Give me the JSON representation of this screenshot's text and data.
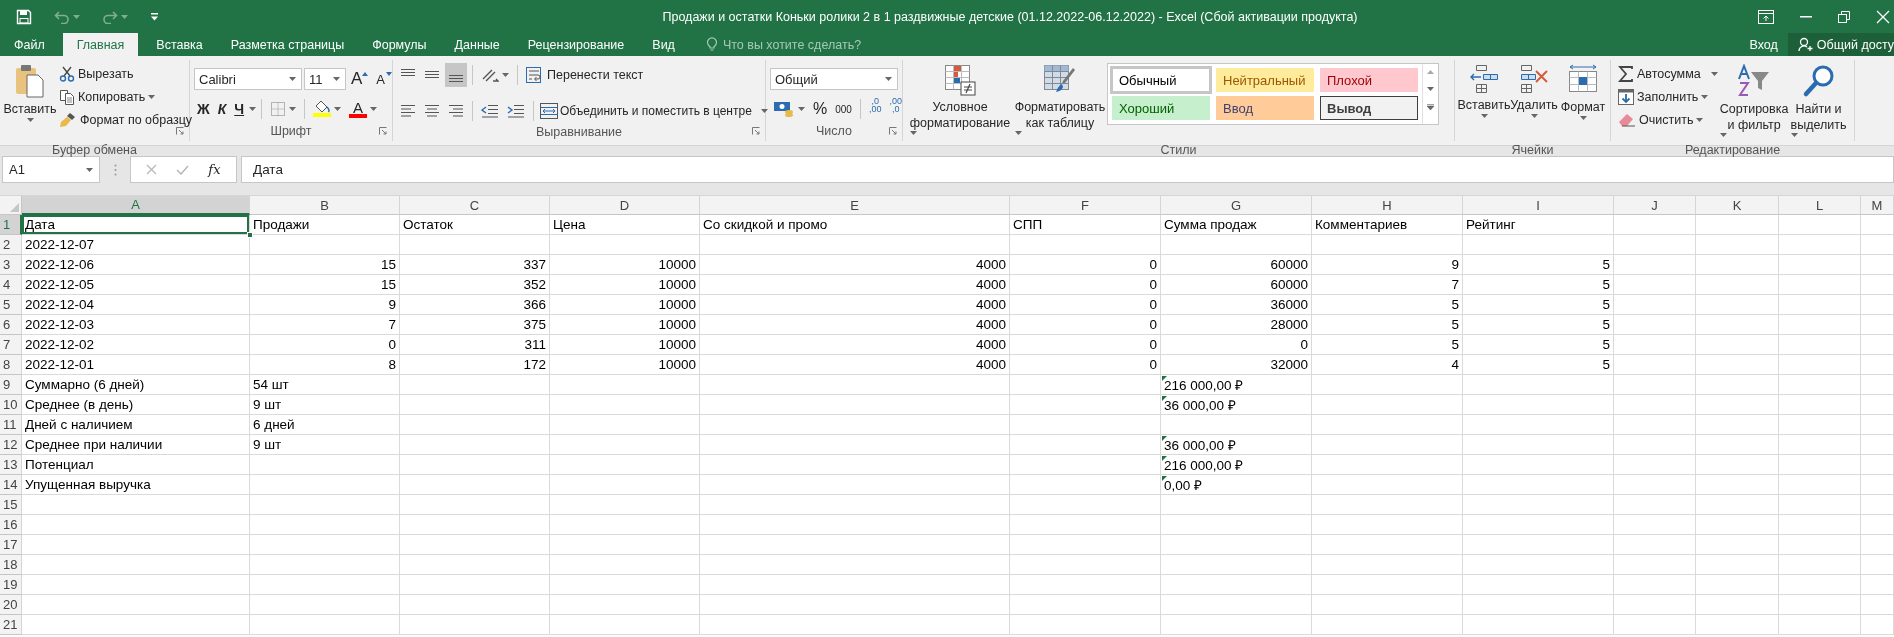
{
  "window": {
    "title": "Продажи и остатки Коньки ролики 2 в 1  раздвижные детские (01.12.2022-06.12.2022) - Excel (Сбой активации продукта)"
  },
  "quick_access": [
    {
      "kind": "save",
      "disabled": false
    },
    {
      "kind": "undo",
      "disabled": true
    },
    {
      "kind": "redo",
      "disabled": true
    },
    {
      "kind": "customize",
      "disabled": false
    }
  ],
  "tabs": [
    {
      "label": "Файл",
      "selected": false
    },
    {
      "label": "Главная",
      "selected": true
    },
    {
      "label": "Вставка",
      "selected": false
    },
    {
      "label": "Разметка страницы",
      "selected": false
    },
    {
      "label": "Формулы",
      "selected": false
    },
    {
      "label": "Данные",
      "selected": false
    },
    {
      "label": "Рецензирование",
      "selected": false
    },
    {
      "label": "Вид",
      "selected": false
    }
  ],
  "tell_me": {
    "placeholder": "Что вы хотите сделать?"
  },
  "account": {
    "sign_in": "Вход",
    "share": "Общий досту"
  },
  "clipboard": {
    "paste": "Вставить",
    "cut": "Вырезать",
    "copy": "Копировать",
    "format_painter": "Формат по образцу",
    "label": "Буфер обмена"
  },
  "font": {
    "name": "Calibri",
    "size": "11",
    "grow": "A",
    "shrink": "A",
    "bold": "Ж",
    "italic": "К",
    "underline": "Ч",
    "font_color": "A",
    "fill_color": {
      "color": "#ffff00"
    },
    "text_color": {
      "color": "#ff0000"
    },
    "label": "Шрифт"
  },
  "alignment": {
    "vertical": [
      {
        "kind": "top",
        "selected": false
      },
      {
        "kind": "middle",
        "selected": false
      },
      {
        "kind": "bottom",
        "selected": true
      }
    ],
    "wrap": "Перенести текст",
    "merge": "Объединить и поместить в центре",
    "label": "Выравнивание"
  },
  "number": {
    "format": "Общий",
    "percent": "%",
    "thousands": "000",
    "decimal_increase": [
      ",0",
      ",00"
    ],
    "decimal_decrease": [
      ",00",
      ",0"
    ],
    "label": "Число"
  },
  "styles": {
    "conditional": [
      "Условное",
      "форматирование"
    ],
    "format_table": [
      "Форматировать",
      "как таблицу"
    ],
    "gallery": [
      {
        "label": "Обычный",
        "kind": "normal",
        "color": "#ffffff",
        "text_color": {
          "color": "#000000"
        },
        "selected": true
      },
      {
        "label": "Нейтральный",
        "kind": "neutral",
        "color": "#ffeb9c",
        "text_color": {
          "color": "#9c5700"
        },
        "selected": false
      },
      {
        "label": "Плохой",
        "kind": "bad",
        "color": "#ffc7ce",
        "text_color": {
          "color": "#9c0006"
        },
        "selected": false
      },
      {
        "label": "Хороший",
        "kind": "good",
        "color": "#c6efce",
        "text_color": {
          "color": "#006100"
        },
        "selected": false
      },
      {
        "label": "Ввод",
        "kind": "input",
        "color": "#ffcc99",
        "text_color": {
          "color": "#3f3f76"
        },
        "selected": false
      },
      {
        "label": "Вывод",
        "kind": "output",
        "color": "#f2f2f2",
        "text_color": {
          "color": "#3f3f3f"
        },
        "selected": false
      }
    ],
    "label": "Стили"
  },
  "cells": {
    "insert": "Вставить",
    "delete": "Удалить",
    "format": "Формат",
    "label": "Ячейки"
  },
  "editing": {
    "autosum": "Автосумма",
    "fill": "Заполнить",
    "clear": "Очистить",
    "sort": [
      "Сортировка",
      "и фильтр"
    ],
    "find": [
      "Найти и",
      "выделить"
    ],
    "label": "Редактирование"
  },
  "formula_bar": {
    "name_box": "A1",
    "function": "fx",
    "formula": "Дата"
  },
  "sheet": {
    "columns": [
      {
        "label": "A",
        "selected": true
      },
      {
        "label": "B",
        "selected": false
      },
      {
        "label": "C",
        "selected": false
      },
      {
        "label": "D",
        "selected": false
      },
      {
        "label": "E",
        "selected": false
      },
      {
        "label": "F",
        "selected": false
      },
      {
        "label": "G",
        "selected": false
      },
      {
        "label": "H",
        "selected": false
      },
      {
        "label": "I",
        "selected": false
      },
      {
        "label": "J",
        "selected": false
      },
      {
        "label": "K",
        "selected": false
      },
      {
        "label": "L",
        "selected": false
      },
      {
        "label": "M",
        "selected": false
      }
    ],
    "rows": [
      {
        "number": "1",
        "selected": true,
        "cells": [
          {
            "text": "Дата",
            "kind": "text",
            "flag": false
          },
          {
            "text": "Продажи",
            "kind": "text",
            "flag": false
          },
          {
            "text": "Остаток",
            "kind": "text",
            "flag": false
          },
          {
            "text": "Цена",
            "kind": "text",
            "flag": false
          },
          {
            "text": "Со скидкой и промо",
            "kind": "text",
            "flag": false
          },
          {
            "text": "СПП",
            "kind": "text",
            "flag": false
          },
          {
            "text": "Сумма продаж",
            "kind": "text",
            "flag": false
          },
          {
            "text": "Комментариев",
            "kind": "text",
            "flag": false
          },
          {
            "text": "Рейтинг",
            "kind": "text",
            "flag": false
          },
          null,
          null,
          null,
          null
        ]
      },
      {
        "number": "2",
        "selected": false,
        "cells": [
          {
            "text": "2022-12-07",
            "kind": "text",
            "flag": false
          },
          null,
          null,
          null,
          null,
          null,
          null,
          null,
          null,
          null,
          null,
          null,
          null
        ]
      },
      {
        "number": "3",
        "selected": false,
        "cells": [
          {
            "text": "2022-12-06",
            "kind": "text",
            "flag": false
          },
          {
            "text": "15",
            "kind": "number",
            "flag": false
          },
          {
            "text": "337",
            "kind": "number",
            "flag": false
          },
          {
            "text": "10000",
            "kind": "number",
            "flag": false
          },
          {
            "text": "4000",
            "kind": "number",
            "flag": false
          },
          {
            "text": "0",
            "kind": "number",
            "flag": false
          },
          {
            "text": "60000",
            "kind": "number",
            "flag": false
          },
          {
            "text": "9",
            "kind": "number",
            "flag": false
          },
          {
            "text": "5",
            "kind": "number",
            "flag": false
          },
          null,
          null,
          null,
          null
        ]
      },
      {
        "number": "4",
        "selected": false,
        "cells": [
          {
            "text": "2022-12-05",
            "kind": "text",
            "flag": false
          },
          {
            "text": "15",
            "kind": "number",
            "flag": false
          },
          {
            "text": "352",
            "kind": "number",
            "flag": false
          },
          {
            "text": "10000",
            "kind": "number",
            "flag": false
          },
          {
            "text": "4000",
            "kind": "number",
            "flag": false
          },
          {
            "text": "0",
            "kind": "number",
            "flag": false
          },
          {
            "text": "60000",
            "kind": "number",
            "flag": false
          },
          {
            "text": "7",
            "kind": "number",
            "flag": false
          },
          {
            "text": "5",
            "kind": "number",
            "flag": false
          },
          null,
          null,
          null,
          null
        ]
      },
      {
        "number": "5",
        "selected": false,
        "cells": [
          {
            "text": "2022-12-04",
            "kind": "text",
            "flag": false
          },
          {
            "text": "9",
            "kind": "number",
            "flag": false
          },
          {
            "text": "366",
            "kind": "number",
            "flag": false
          },
          {
            "text": "10000",
            "kind": "number",
            "flag": false
          },
          {
            "text": "4000",
            "kind": "number",
            "flag": false
          },
          {
            "text": "0",
            "kind": "number",
            "flag": false
          },
          {
            "text": "36000",
            "kind": "number",
            "flag": false
          },
          {
            "text": "5",
            "kind": "number",
            "flag": false
          },
          {
            "text": "5",
            "kind": "number",
            "flag": false
          },
          null,
          null,
          null,
          null
        ]
      },
      {
        "number": "6",
        "selected": false,
        "cells": [
          {
            "text": "2022-12-03",
            "kind": "text",
            "flag": false
          },
          {
            "text": "7",
            "kind": "number",
            "flag": false
          },
          {
            "text": "375",
            "kind": "number",
            "flag": false
          },
          {
            "text": "10000",
            "kind": "number",
            "flag": false
          },
          {
            "text": "4000",
            "kind": "number",
            "flag": false
          },
          {
            "text": "0",
            "kind": "number",
            "flag": false
          },
          {
            "text": "28000",
            "kind": "number",
            "flag": false
          },
          {
            "text": "5",
            "kind": "number",
            "flag": false
          },
          {
            "text": "5",
            "kind": "number",
            "flag": false
          },
          null,
          null,
          null,
          null
        ]
      },
      {
        "number": "7",
        "selected": false,
        "cells": [
          {
            "text": "2022-12-02",
            "kind": "text",
            "flag": false
          },
          {
            "text": "0",
            "kind": "number",
            "flag": false
          },
          {
            "text": "311",
            "kind": "number",
            "flag": false
          },
          {
            "text": "10000",
            "kind": "number",
            "flag": false
          },
          {
            "text": "4000",
            "kind": "number",
            "flag": false
          },
          {
            "text": "0",
            "kind": "number",
            "flag": false
          },
          {
            "text": "0",
            "kind": "number",
            "flag": false
          },
          {
            "text": "5",
            "kind": "number",
            "flag": false
          },
          {
            "text": "5",
            "kind": "number",
            "flag": false
          },
          null,
          null,
          null,
          null
        ]
      },
      {
        "number": "8",
        "selected": false,
        "cells": [
          {
            "text": "2022-12-01",
            "kind": "text",
            "flag": false
          },
          {
            "text": "8",
            "kind": "number",
            "flag": false
          },
          {
            "text": "172",
            "kind": "number",
            "flag": false
          },
          {
            "text": "10000",
            "kind": "number",
            "flag": false
          },
          {
            "text": "4000",
            "kind": "number",
            "flag": false
          },
          {
            "text": "0",
            "kind": "number",
            "flag": false
          },
          {
            "text": "32000",
            "kind": "number",
            "flag": false
          },
          {
            "text": "4",
            "kind": "number",
            "flag": false
          },
          {
            "text": "5",
            "kind": "number",
            "flag": false
          },
          null,
          null,
          null,
          null
        ]
      },
      {
        "number": "9",
        "selected": false,
        "cells": [
          {
            "text": "Суммарно (6 дней)",
            "kind": "text",
            "flag": false
          },
          {
            "text": "54 шт",
            "kind": "text",
            "flag": false
          },
          null,
          null,
          null,
          null,
          {
            "text": "216 000,00 ₽",
            "kind": "text",
            "flag": true
          },
          null,
          null,
          null,
          null,
          null,
          null
        ]
      },
      {
        "number": "10",
        "selected": false,
        "cells": [
          {
            "text": "Среднее (в день)",
            "kind": "text",
            "flag": false
          },
          {
            "text": "9 шт",
            "kind": "text",
            "flag": false
          },
          null,
          null,
          null,
          null,
          {
            "text": "36 000,00 ₽",
            "kind": "text",
            "flag": true
          },
          null,
          null,
          null,
          null,
          null,
          null
        ]
      },
      {
        "number": "11",
        "selected": false,
        "cells": [
          {
            "text": "Дней с наличием",
            "kind": "text",
            "flag": false
          },
          {
            "text": "6 дней",
            "kind": "text",
            "flag": false
          },
          null,
          null,
          null,
          null,
          null,
          null,
          null,
          null,
          null,
          null,
          null
        ]
      },
      {
        "number": "12",
        "selected": false,
        "cells": [
          {
            "text": "Среднее при наличии",
            "kind": "text",
            "flag": false
          },
          {
            "text": "9 шт",
            "kind": "text",
            "flag": false
          },
          null,
          null,
          null,
          null,
          {
            "text": "36 000,00 ₽",
            "kind": "text",
            "flag": true
          },
          null,
          null,
          null,
          null,
          null,
          null
        ]
      },
      {
        "number": "13",
        "selected": false,
        "cells": [
          {
            "text": "Потенциал",
            "kind": "text",
            "flag": false
          },
          null,
          null,
          null,
          null,
          null,
          {
            "text": "216 000,00 ₽",
            "kind": "text",
            "flag": true
          },
          null,
          null,
          null,
          null,
          null,
          null
        ]
      },
      {
        "number": "14",
        "selected": false,
        "cells": [
          {
            "text": "Упущенная выручка",
            "kind": "text",
            "flag": false
          },
          null,
          null,
          null,
          null,
          null,
          {
            "text": "0,00 ₽",
            "kind": "text",
            "flag": true
          },
          null,
          null,
          null,
          null,
          null,
          null
        ]
      },
      {
        "number": "15",
        "selected": false
      },
      {
        "number": "16",
        "selected": false
      },
      {
        "number": "17",
        "selected": false
      },
      {
        "number": "18",
        "selected": false
      },
      {
        "number": "19",
        "selected": false
      },
      {
        "number": "20",
        "selected": false
      },
      {
        "number": "21",
        "selected": false
      }
    ]
  }
}
